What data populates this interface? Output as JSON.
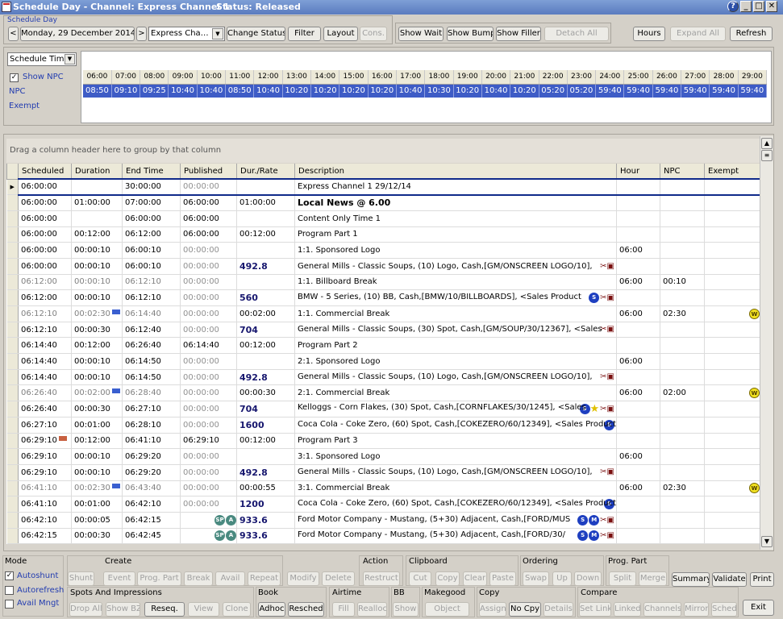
{
  "window": {
    "title": "Schedule Day - Channel: Express Channel 1",
    "status": "Status: Released",
    "controls": [
      "?",
      "_",
      "□",
      "✕"
    ]
  },
  "toolbar": {
    "section_label": "Schedule Day",
    "prev": "<",
    "date": "Monday, 29 December 2014",
    "next": ">",
    "channel_value": "Express Cha…",
    "change_status": "Change Status",
    "filter": "Filter",
    "layout": "Layout",
    "cons": "Cons.",
    "show_wait": "Show Wait",
    "show_bump": "Show Bump",
    "show_filler": "Show Filler",
    "detach_all": "Detach All",
    "hours": "Hours",
    "expand_all": "Expand All",
    "refresh": "Refresh"
  },
  "left_panel": {
    "view_select": "Schedule Time",
    "show_npc": "Show NPC",
    "npc": "NPC",
    "exempt": "Exempt"
  },
  "hours_grid": {
    "headers": [
      "06:00",
      "07:00",
      "08:00",
      "09:00",
      "10:00",
      "11:00",
      "12:00",
      "13:00",
      "14:00",
      "15:00",
      "16:00",
      "17:00",
      "18:00",
      "19:00",
      "20:00",
      "21:00",
      "22:00",
      "23:00",
      "24:00",
      "25:00",
      "26:00",
      "27:00",
      "28:00",
      "29:00"
    ],
    "values": [
      "08:50",
      "09:10",
      "09:25",
      "10:40",
      "10:40",
      "08:50",
      "10:40",
      "10:20",
      "10:20",
      "10:20",
      "10:20",
      "10:40",
      "10:30",
      "10:20",
      "10:40",
      "10:20",
      "05:20",
      "05:20",
      "59:40",
      "59:40",
      "59:40",
      "59:40",
      "59:40",
      "59:40"
    ]
  },
  "group_hint": "Drag a column header here to group by that column",
  "columns": [
    "Scheduled",
    "Duration",
    "End Time",
    "Published",
    "Dur./Rate",
    "Description",
    "Hour",
    "NPC",
    "Exempt"
  ],
  "rows": [
    {
      "sched": "06:00:00",
      "dur": "",
      "end": "30:00:00",
      "pub": "00:00:00",
      "rate": "",
      "desc": "Express Channel 1 29/12/14",
      "hour": "",
      "npc": "",
      "exempt": "",
      "sel": true,
      "pubgrey": true
    },
    {
      "sched": "06:00:00",
      "dur": "01:00:00",
      "end": "07:00:00",
      "pub": "06:00:00",
      "rate": "01:00:00",
      "desc": "Local News @ 6.00",
      "descbold": true,
      "hour": "",
      "npc": "",
      "exempt": ""
    },
    {
      "sched": "06:00:00",
      "dur": "",
      "end": "06:00:00",
      "pub": "06:00:00",
      "rate": "",
      "desc": "Content Only Time 1",
      "hour": "",
      "npc": "",
      "exempt": ""
    },
    {
      "sched": "06:00:00",
      "dur": "00:12:00",
      "end": "06:12:00",
      "pub": "06:00:00",
      "rate": "00:12:00",
      "desc": "Program Part 1",
      "hour": "",
      "npc": "",
      "exempt": ""
    },
    {
      "sched": "06:00:00",
      "dur": "00:00:10",
      "end": "06:00:10",
      "pub": "00:00:00",
      "rate": "",
      "desc": "1:1. Sponsored Logo",
      "hour": "06:00",
      "npc": "",
      "exempt": "",
      "pubgrey": true
    },
    {
      "sched": "06:00:00",
      "dur": "00:00:10",
      "end": "06:00:10",
      "pub": "00:00:00",
      "rate": "492.8",
      "ratebold": true,
      "desc": "General Mills - Classic Soups, (10) Logo, Cash,[GM/ONSCREEN LOGO/10],",
      "icons": "tools",
      "hour": "",
      "npc": "",
      "exempt": "",
      "pubgrey": true
    },
    {
      "sched": "06:12:00",
      "dur": "00:00:10",
      "end": "06:12:10",
      "pub": "00:00:00",
      "rate": "",
      "desc": "1:1. Billboard Break",
      "hour": "06:00",
      "npc": "00:10",
      "exempt": "",
      "grey": true
    },
    {
      "sched": "06:12:00",
      "dur": "00:00:10",
      "end": "06:12:10",
      "pub": "00:00:00",
      "rate": "560",
      "ratebold": true,
      "desc": "BMW - 5 Series, (10) BB, Cash,[BMW/10/BILLBOARDS],  <Sales Product",
      "icons": "s-tools",
      "hour": "",
      "npc": "",
      "exempt": "",
      "pubgrey": true
    },
    {
      "sched": "06:12:10",
      "dur": "00:02:30",
      "end": "06:14:40",
      "pub": "00:00:00",
      "rate": "00:02:00",
      "desc": "1:1. Commercial Break",
      "hour": "06:00",
      "npc": "02:30",
      "exempt": "W",
      "grey": true,
      "tag": true
    },
    {
      "sched": "06:12:10",
      "dur": "00:00:30",
      "end": "06:12:40",
      "pub": "00:00:00",
      "rate": "704",
      "ratebold": true,
      "desc": "General Mills - Classic Soups, (30) Spot, Cash,[GM/SOUP/30/12367],  <Sales",
      "icons": "tools",
      "hour": "",
      "npc": "",
      "exempt": "",
      "pubgrey": true
    },
    {
      "sched": "06:14:40",
      "dur": "00:12:00",
      "end": "06:26:40",
      "pub": "06:14:40",
      "rate": "00:12:00",
      "desc": "Program Part 2",
      "hour": "",
      "npc": "",
      "exempt": ""
    },
    {
      "sched": "06:14:40",
      "dur": "00:00:10",
      "end": "06:14:50",
      "pub": "00:00:00",
      "rate": "",
      "desc": "2:1. Sponsored Logo",
      "hour": "06:00",
      "npc": "",
      "exempt": "",
      "pubgrey": true
    },
    {
      "sched": "06:14:40",
      "dur": "00:00:10",
      "end": "06:14:50",
      "pub": "00:00:00",
      "rate": "492.8",
      "ratebold": true,
      "desc": "General Mills - Classic Soups, (10) Logo, Cash,[GM/ONSCREEN LOGO/10],",
      "icons": "tools",
      "hour": "",
      "npc": "",
      "exempt": "",
      "pubgrey": true
    },
    {
      "sched": "06:26:40",
      "dur": "00:02:00",
      "end": "06:28:40",
      "pub": "00:00:00",
      "rate": "00:00:30",
      "desc": "2:1. Commercial Break",
      "hour": "06:00",
      "npc": "02:00",
      "exempt": "W",
      "grey": true,
      "tag": true
    },
    {
      "sched": "06:26:40",
      "dur": "00:00:30",
      "end": "06:27:10",
      "pub": "00:00:00",
      "rate": "704",
      "ratebold": true,
      "desc": "Kelloggs - Corn Flakes, (30) Spot, Cash,[CORNFLAKES/30/1245],  <Sales",
      "icons": "s-star",
      "hour": "",
      "npc": "",
      "exempt": "",
      "pubgrey": true
    },
    {
      "sched": "06:27:10",
      "dur": "00:01:00",
      "end": "06:28:10",
      "pub": "00:00:00",
      "rate": "1600",
      "ratebold": true,
      "desc": "Coca Cola - Coke Zero, (60) Spot, Cash,[COKEZERO/60/12349],  <Sales Product",
      "icons": "s",
      "hour": "",
      "npc": "",
      "exempt": "",
      "pubgrey": true
    },
    {
      "sched": "06:29:10",
      "dur": "00:12:00",
      "end": "06:41:10",
      "pub": "06:29:10",
      "rate": "00:12:00",
      "desc": "Program Part 3",
      "hour": "",
      "npc": "",
      "exempt": "",
      "tag2": true
    },
    {
      "sched": "06:29:10",
      "dur": "00:00:10",
      "end": "06:29:20",
      "pub": "00:00:00",
      "rate": "",
      "desc": "3:1. Sponsored Logo",
      "hour": "06:00",
      "npc": "",
      "exempt": "",
      "pubgrey": true
    },
    {
      "sched": "06:29:10",
      "dur": "00:00:10",
      "end": "06:29:20",
      "pub": "00:00:00",
      "rate": "492.8",
      "ratebold": true,
      "desc": "General Mills - Classic Soups, (10) Logo, Cash,[GM/ONSCREEN LOGO/10],",
      "icons": "tools",
      "hour": "",
      "npc": "",
      "exempt": "",
      "pubgrey": true
    },
    {
      "sched": "06:41:10",
      "dur": "00:02:30",
      "end": "06:43:40",
      "pub": "00:00:00",
      "rate": "00:00:55",
      "desc": "3:1. Commercial Break",
      "hour": "06:00",
      "npc": "02:30",
      "exempt": "W",
      "grey": true,
      "tag": true
    },
    {
      "sched": "06:41:10",
      "dur": "00:01:00",
      "end": "06:42:10",
      "pub": "00:00:00",
      "rate": "1200",
      "ratebold": true,
      "desc": "Coca Cola - Coke Zero, (60) Spot, Cash,[COKEZERO/60/12349],  <Sales Product",
      "icons": "s",
      "hour": "",
      "npc": "",
      "exempt": "",
      "pubgrey": true
    },
    {
      "sched": "06:42:10",
      "dur": "00:00:05",
      "end": "06:42:15",
      "pub": "",
      "rate": "933.6",
      "ratebold": true,
      "desc": "Ford Motor Company - Mustang, (5+30) Adjacent, Cash,[FORD/MUS",
      "icons": "s-m-tools",
      "pubicons": true,
      "hour": "",
      "npc": "",
      "exempt": ""
    },
    {
      "sched": "06:42:15",
      "dur": "00:00:30",
      "end": "06:42:45",
      "pub": "",
      "rate": "933.6",
      "ratebold": true,
      "desc": "Ford Motor Company - Mustang, (5+30) Adjacent, Cash,[FORD/30/",
      "icons": "s-m-tools",
      "pubicons": true,
      "hour": "",
      "npc": "",
      "exempt": ""
    }
  ],
  "icon_glyphs": {
    "s": "S",
    "m": "M",
    "w": "W",
    "sp": "SP",
    "a": "A",
    "star": "★",
    "tools": "✂▣",
    "tag": "…"
  },
  "bottom": {
    "mode": {
      "title": "Mode",
      "autoshunt": "Autoshunt",
      "autorefresh": "Autorefresh",
      "avail_mngt": "Avail Mngt"
    },
    "create": {
      "title": "Create",
      "shunt": "Shunt",
      "event": "Event",
      "prog_part": "Prog. Part",
      "break": "Break",
      "avail": "Avail",
      "repeat": "Repeat"
    },
    "modify": "Modify",
    "delete": "Delete",
    "action": {
      "title": "Action",
      "restruct": "Restruct"
    },
    "clipboard": {
      "title": "Clipboard",
      "cut": "Cut",
      "copy": "Copy",
      "clear": "Clear",
      "paste": "Paste"
    },
    "ordering": {
      "title": "Ordering",
      "swap": "Swap",
      "up": "Up",
      "down": "Down"
    },
    "prog_part": {
      "title": "Prog. Part",
      "split": "Split",
      "merge": "Merge"
    },
    "summary": "Summary",
    "validate": "Validate",
    "print": "Print",
    "spots": {
      "title": "Spots And Impressions",
      "drop_all": "Drop All",
      "show_bz": "Show BZ",
      "reseq": "Reseq.",
      "view": "View",
      "clone": "Clone"
    },
    "book": {
      "title": "Book",
      "adhoc": "Adhoc",
      "resched": "Resched"
    },
    "airtime": {
      "title": "Airtime",
      "fill": "Fill",
      "realloc": "Realloc"
    },
    "bb": {
      "title": "BB",
      "show": "Show"
    },
    "makegood": {
      "title": "Makegood",
      "object": "Object"
    },
    "copy": {
      "title": "Copy",
      "assign": "Assign",
      "no_cpy": "No Cpy",
      "details": "Details"
    },
    "compare": {
      "title": "Compare",
      "set_link": "Set Link",
      "linked": "Linked",
      "channels": "Channels",
      "mirror": "Mirror",
      "sched": "Sched"
    },
    "exit": "Exit"
  },
  "colors": {
    "selection": "#3e5cc6",
    "header": "#ece9d8",
    "bold_rate": "#16166e",
    "status_icon": "#1e3fc0",
    "warn_icon": "#f0e020"
  }
}
